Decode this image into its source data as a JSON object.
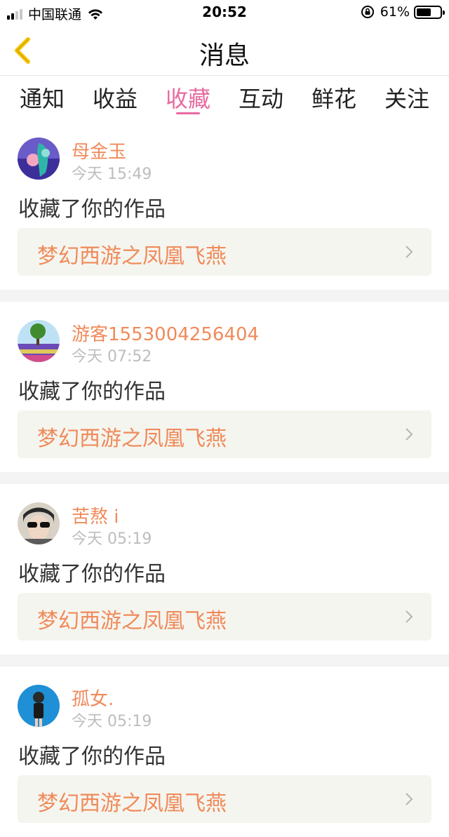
{
  "status_bar": {
    "carrier": "中国联通",
    "time": "20:52",
    "battery_percent": "61%",
    "battery_level": 0.61,
    "signal_bars_active": 2,
    "signal_bars_total": 4
  },
  "nav": {
    "title": "消息",
    "back_icon": "chevron-left-icon",
    "accent_color": "#f5c400"
  },
  "tabs": [
    {
      "label": "通知",
      "active": false
    },
    {
      "label": "收益",
      "active": false
    },
    {
      "label": "收藏",
      "active": true
    },
    {
      "label": "互动",
      "active": false
    },
    {
      "label": "鲜花",
      "active": false
    },
    {
      "label": "关注",
      "active": false
    }
  ],
  "colors": {
    "active_tab": "#e86aa0",
    "username": "#f08a5a",
    "timestamp": "#bdbdbd",
    "card_background": "#f5f5ef"
  },
  "messages": [
    {
      "username": "母金玉",
      "time": "今天 15:49",
      "action": "收藏了你的作品",
      "work_title": "梦幻西游之凤凰飞燕"
    },
    {
      "username": "游客1553004256404",
      "time": "今天 07:52",
      "action": "收藏了你的作品",
      "work_title": "梦幻西游之凤凰飞燕"
    },
    {
      "username": "苦熬 i",
      "time": "今天 05:19",
      "action": "收藏了你的作品",
      "work_title": "梦幻西游之凤凰飞燕"
    },
    {
      "username": "孤女.",
      "time": "今天 05:19",
      "action": "收藏了你的作品",
      "work_title": "梦幻西游之凤凰飞燕"
    }
  ]
}
